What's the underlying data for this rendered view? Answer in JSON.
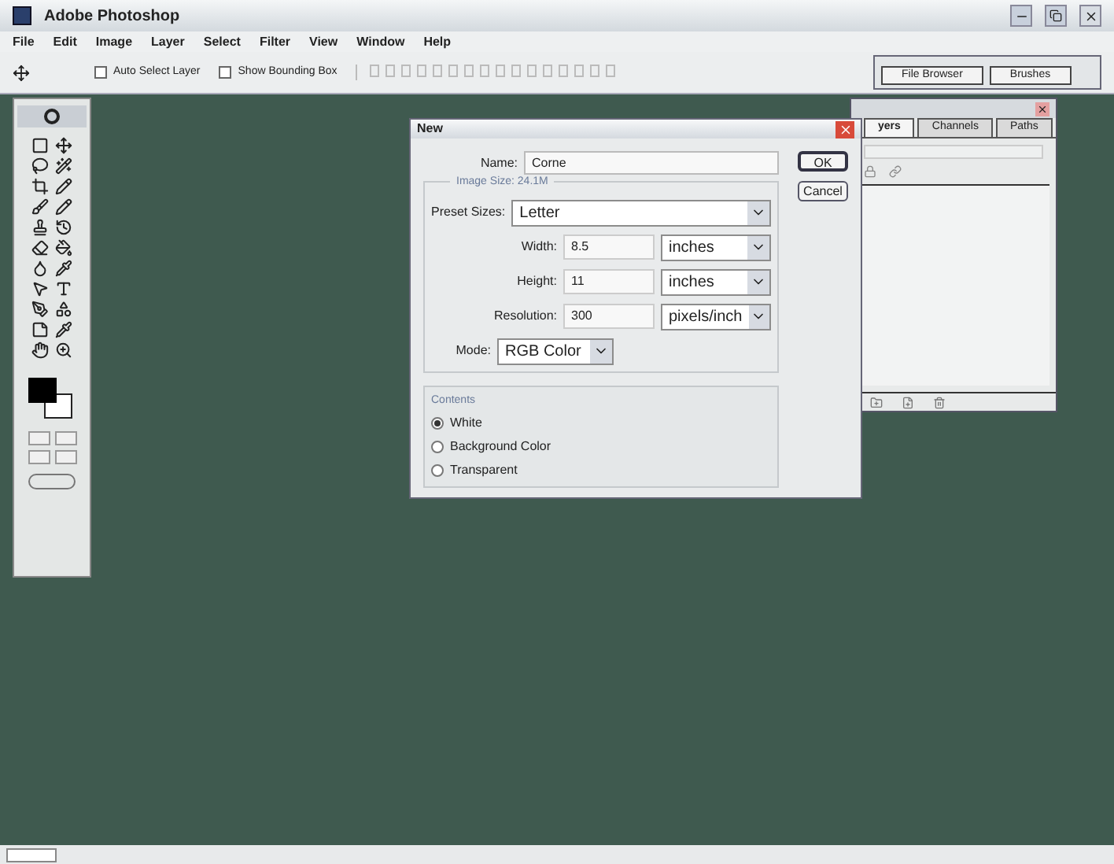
{
  "window": {
    "title": "Adobe Photoshop"
  },
  "menu": [
    "File",
    "Edit",
    "Image",
    "Layer",
    "Select",
    "Filter",
    "View",
    "Window",
    "Help"
  ],
  "options": [
    {
      "label": "Auto Select Layer",
      "checked": false
    },
    {
      "label": "Show Bounding Box",
      "checked": false
    }
  ],
  "palette_well": [
    {
      "label": "File Browser",
      "selected": false
    },
    {
      "label": "Brushes",
      "selected": false
    }
  ],
  "layers_panel": {
    "tabs": [
      {
        "label": "yers",
        "selected": true
      },
      {
        "label": "Channels",
        "selected": false
      },
      {
        "label": "Paths",
        "selected": false
      }
    ]
  },
  "dialog": {
    "title": "New",
    "name_label": "Name:",
    "name": "Corne",
    "image_size": "Image Size: 24.1M",
    "preset_label": "Preset Sizes:",
    "preset": "Letter",
    "fields": [
      {
        "label": "Width:",
        "value": "8.5",
        "unit": "inches"
      },
      {
        "label": "Height:",
        "value": "11",
        "unit": "inches"
      },
      {
        "label": "Resolution:",
        "value": "300",
        "unit": "pixels/inch"
      }
    ],
    "mode_label": "Mode:",
    "mode": "RGB Color",
    "contents_label": "Contents",
    "contents": [
      {
        "label": "White",
        "selected": true
      },
      {
        "label": "Background Color",
        "selected": false
      },
      {
        "label": "Transparent",
        "selected": false
      }
    ],
    "buttons": [
      "OK",
      "Cancel"
    ]
  }
}
